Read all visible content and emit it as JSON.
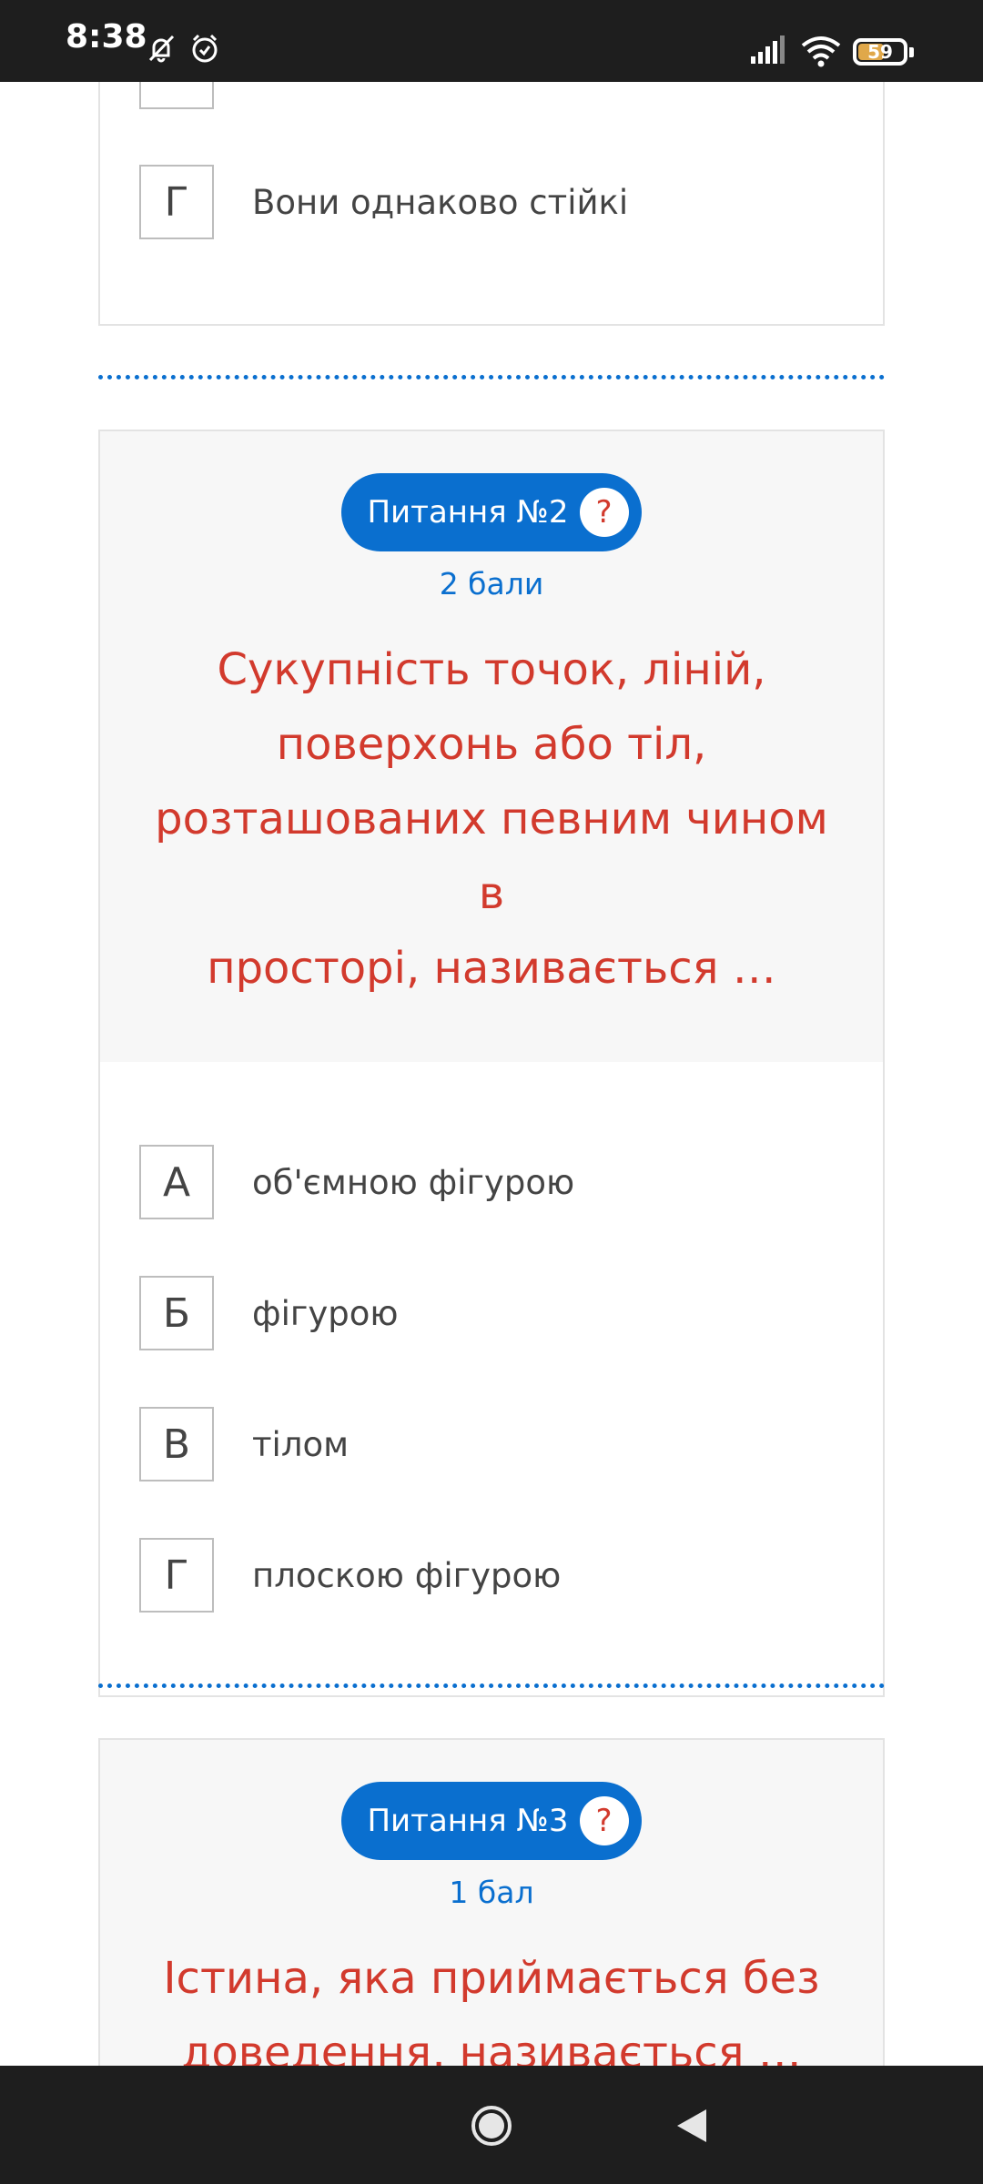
{
  "status": {
    "time": "8:38",
    "battery": "59",
    "battery_fill": 0.59,
    "icons": [
      "bell-off-icon",
      "alarm-icon",
      "signal-icon",
      "wifi-icon",
      "battery-icon"
    ]
  },
  "prev_question": {
    "option_g_letter": "Г",
    "option_g_text": "Вони однаково стійкі"
  },
  "question2": {
    "label": "Питання №2",
    "help": "?",
    "points": "2 бали",
    "lines": [
      "Сукупність точок, ліній,",
      "поверхонь або тіл,",
      "розташованих певним чином в",
      "просторі, називається …"
    ],
    "options": [
      {
        "letter": "А",
        "text": "об'ємною фігурою"
      },
      {
        "letter": "Б",
        "text": "фігурою"
      },
      {
        "letter": "В",
        "text": "тілом"
      },
      {
        "letter": "Г",
        "text": "плоскою фігурою"
      }
    ]
  },
  "question3": {
    "label": "Питання №3",
    "help": "?",
    "points": "1 бал",
    "lines": [
      "Істина, яка приймається без",
      "доведення, називається …"
    ]
  },
  "colors": {
    "accent": "#0a6fcf",
    "question_text": "#d23a2d",
    "status_bar": "#1e1e1e"
  }
}
